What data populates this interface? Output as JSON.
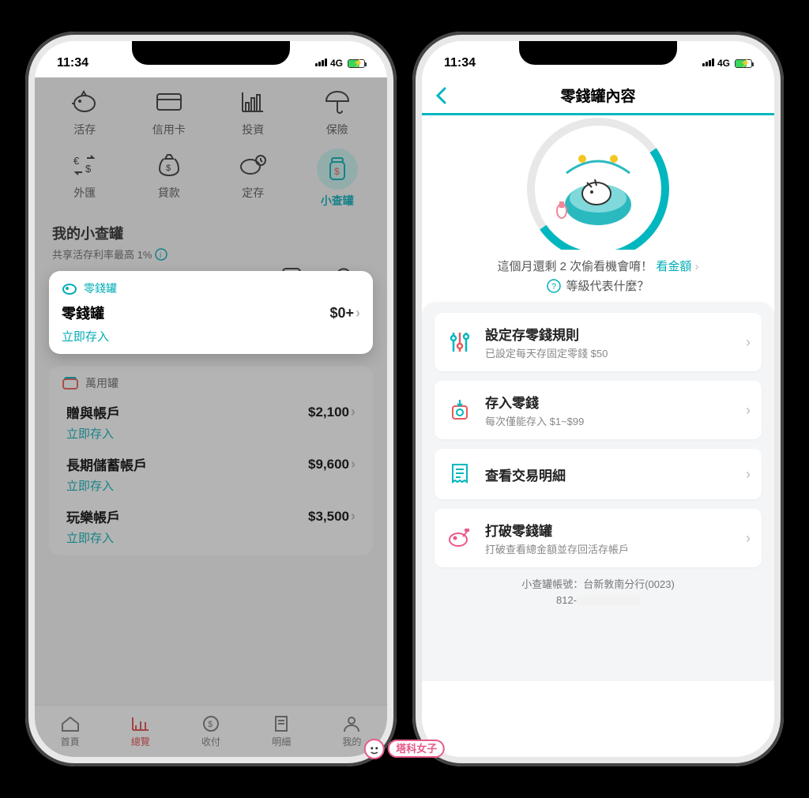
{
  "status": {
    "time": "11:34",
    "net": "4G"
  },
  "left": {
    "shortcuts": [
      {
        "label": "活存",
        "icon": "piggy"
      },
      {
        "label": "信用卡",
        "icon": "card"
      },
      {
        "label": "投資",
        "icon": "chart"
      },
      {
        "label": "保險",
        "icon": "umbrella"
      },
      {
        "label": "外匯",
        "icon": "fx"
      },
      {
        "label": "貸款",
        "icon": "loan"
      },
      {
        "label": "定存",
        "icon": "timepig"
      },
      {
        "label": "小查罐",
        "icon": "jar"
      }
    ],
    "section_title": "我的小查罐",
    "section_sub": "共享活存利率最高 1%",
    "coin_jar": {
      "tag": "零錢罐",
      "title": "零錢罐",
      "amount": "$0+",
      "cta": "立即存入"
    },
    "multi_jar_tag": "萬用罐",
    "accounts": [
      {
        "name": "贈與帳戶",
        "amount": "$2,100",
        "cta": "立即存入"
      },
      {
        "name": "長期儲蓄帳戶",
        "amount": "$9,600",
        "cta": "立即存入"
      },
      {
        "name": "玩樂帳戶",
        "amount": "$3,500",
        "cta": "立即存入"
      }
    ],
    "tabs": [
      {
        "label": "首頁"
      },
      {
        "label": "總覽"
      },
      {
        "label": "收付"
      },
      {
        "label": "明細"
      },
      {
        "label": "我的"
      }
    ]
  },
  "right": {
    "title": "零錢罐內容",
    "remaining_text": "這個月還剩 2 次偷看機會唷！",
    "remaining_link": "看金額",
    "level_text": "等級代表什麼？",
    "options": [
      {
        "title": "設定存零錢規則",
        "sub": "已設定每天存固定零錢 $50",
        "icon": "sliders"
      },
      {
        "title": "存入零錢",
        "sub": "每次僅能存入 $1~$99",
        "icon": "deposit"
      },
      {
        "title": "查看交易明細",
        "sub": "",
        "icon": "receipt"
      },
      {
        "title": "打破零錢罐",
        "sub": "打破查看總金額並存回活存帳戶",
        "icon": "hammer"
      }
    ],
    "footer_line1": "小查罐帳號：台新敦南分行(0023)",
    "footer_line2_prefix": "812-"
  },
  "watermark": "塔科女子"
}
